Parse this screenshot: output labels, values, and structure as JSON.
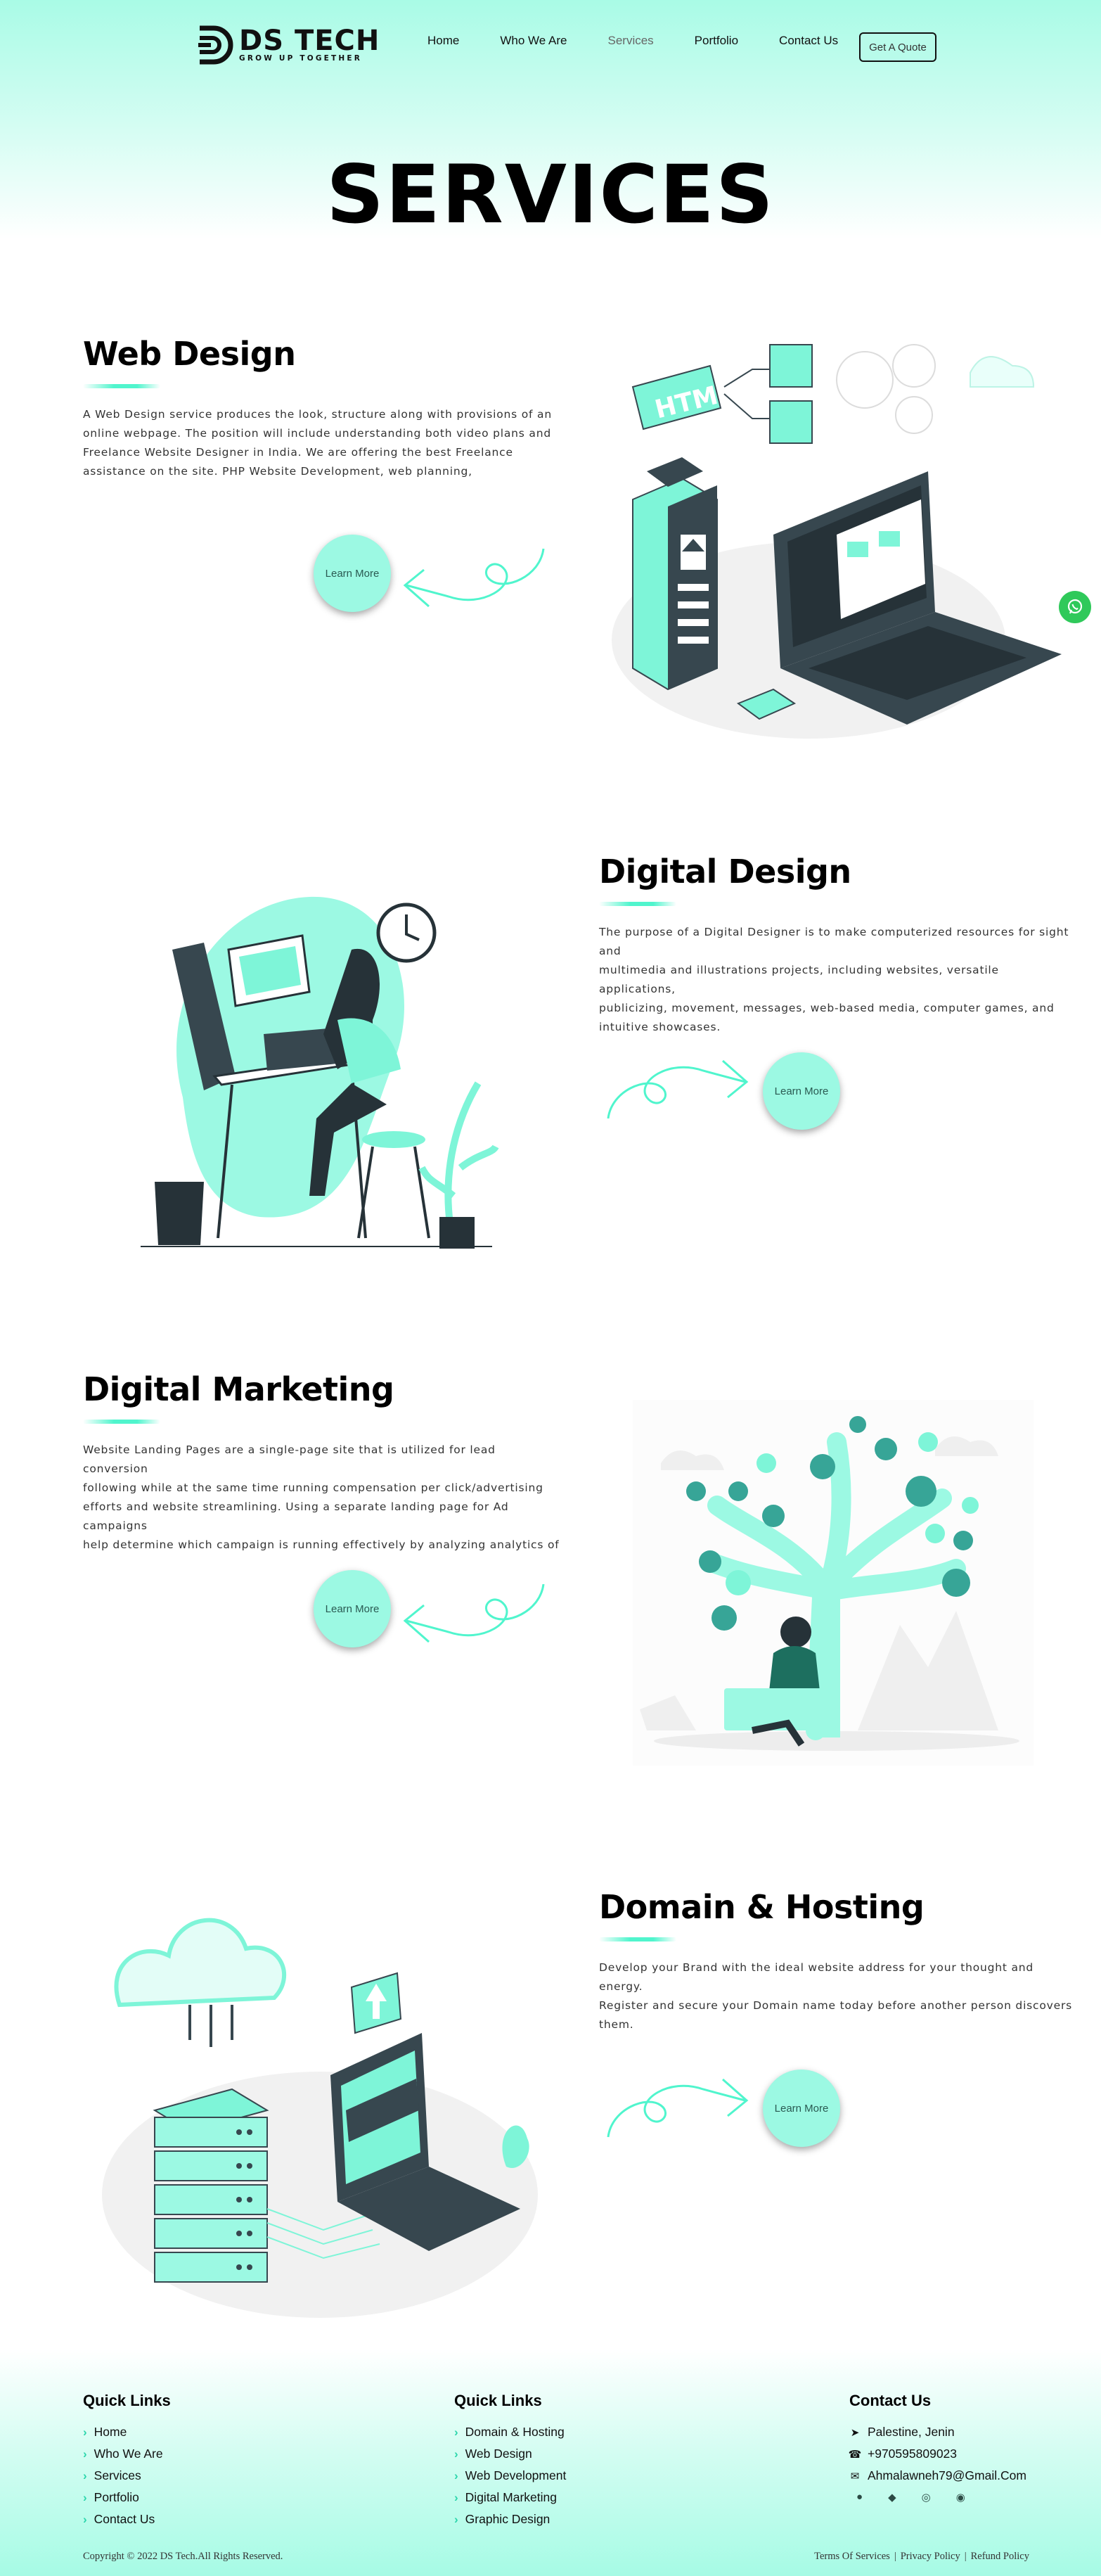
{
  "brand": {
    "name": "DS TECH",
    "tagline": "GROW UP TOGETHER"
  },
  "nav": {
    "items": [
      {
        "label": "Home"
      },
      {
        "label": "Who We Are"
      },
      {
        "label": "Services"
      },
      {
        "label": "Portfolio"
      },
      {
        "label": "Contact Us"
      }
    ],
    "active": "Services",
    "cta": "Get A Quote"
  },
  "page_title": "SERVICES",
  "services": [
    {
      "title": "Web Design",
      "lines": [
        "A Web Design service produces the look, structure along with provisions of an",
        "online webpage. The position will include understanding both video plans and",
        "Freelance Website Designer in India. We are offering the best Freelance",
        "assistance on the site. PHP Website Development, web planning,"
      ],
      "button": "Learn More",
      "illustration": "web-design-illustration"
    },
    {
      "title": "Digital Design",
      "lines": [
        "The purpose of a Digital Designer is to make computerized resources for sight and",
        "multimedia and illustrations projects, including websites, versatile applications,",
        "publicizing, movement, messages, web-based media, computer games, and",
        "intuitive showcases."
      ],
      "button": "Learn More",
      "illustration": "digital-design-illustration"
    },
    {
      "title": "Digital Marketing",
      "lines": [
        "Website Landing Pages are a single-page site that is utilized for lead conversion",
        "following while at the same time running compensation per click/advertising",
        "efforts and website streamlining. Using a separate landing page for Ad campaigns",
        "help determine which campaign is running effectively by analyzing analytics of"
      ],
      "button": "Learn More",
      "illustration": "digital-marketing-illustration"
    },
    {
      "title": "Domain & Hosting",
      "lines": [
        "Develop your Brand with the ideal website address for your thought and energy.",
        "Register and secure your Domain name today before another person discovers",
        "them."
      ],
      "button": "Learn More",
      "illustration": "domain-hosting-illustration"
    }
  ],
  "footer": {
    "quick_links_1": {
      "title": "Quick Links",
      "items": [
        "Home",
        "Who We Are",
        "Services",
        "Portfolio",
        "Contact Us"
      ]
    },
    "quick_links_2": {
      "title": "Quick Links",
      "items": [
        "Domain & Hosting",
        "Web Design",
        "Web Development",
        "Digital Marketing",
        "Graphic Design"
      ]
    },
    "contact": {
      "title": "Contact Us",
      "address": "Palestine, Jenin",
      "phone": "+970595809023",
      "email": "Ahmalawneh79@Gmail.Com",
      "socials": [
        "facebook-icon",
        "twitter-icon",
        "instagram-icon",
        "whatsapp-icon"
      ]
    },
    "copyright": "Copyright © 2022 DS Tech.All Rights Reserved.",
    "legal": [
      "Terms Of Services",
      "|",
      "Privacy Policy",
      "|",
      "Refund Policy"
    ]
  },
  "colors": {
    "accent": "#50f5cd",
    "mint": "#9cf9e3",
    "dark": "#37474f",
    "whatsapp": "#2fc95a"
  }
}
